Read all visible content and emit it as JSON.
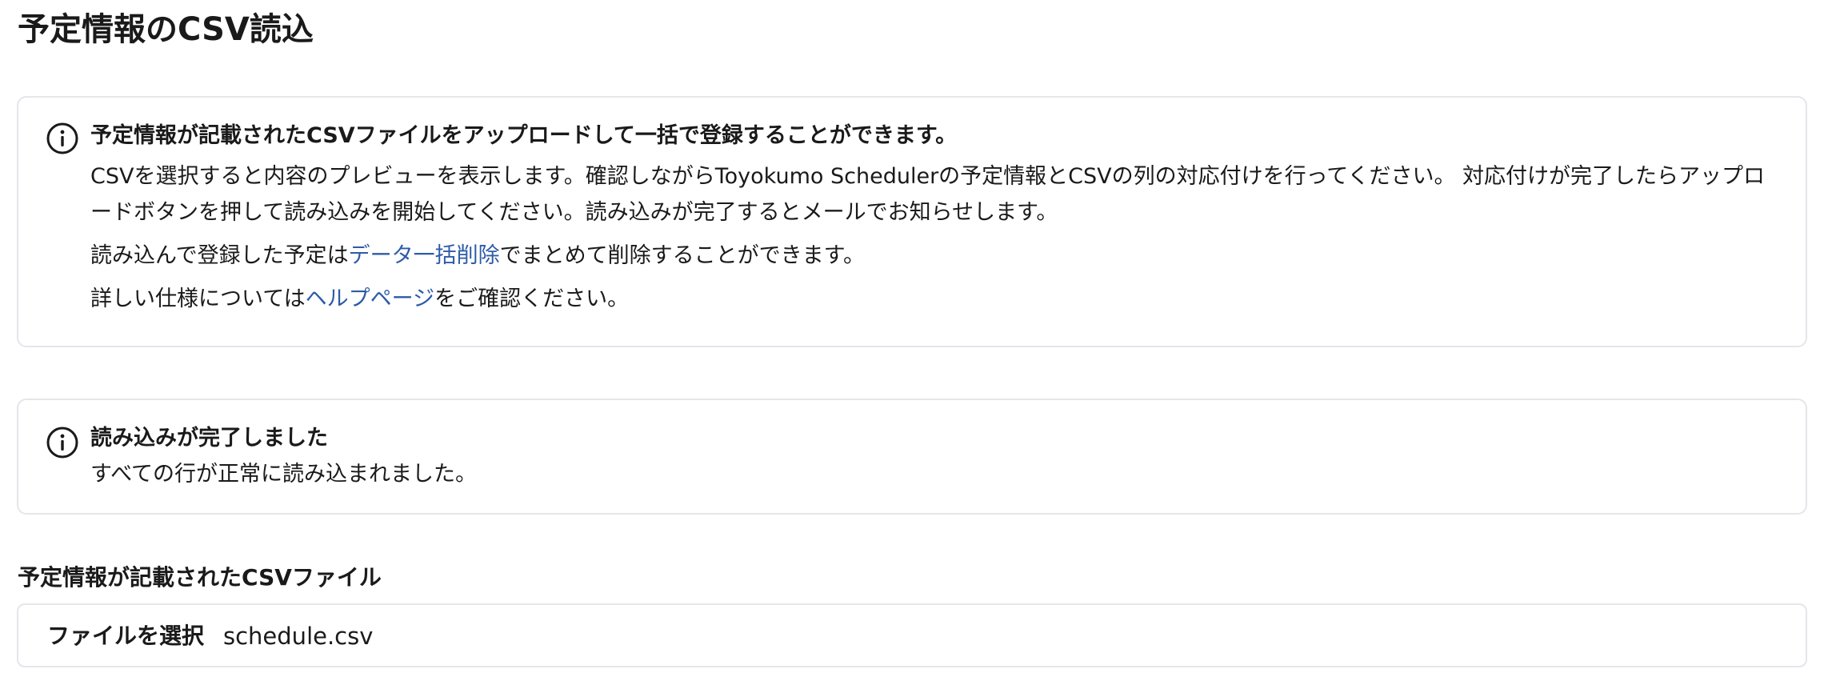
{
  "page": {
    "title": "予定情報のCSV読込"
  },
  "info_box": {
    "icon": "info-icon",
    "heading": "予定情報が記載されたCSVファイルをアップロードして一括で登録することができます。",
    "paragraph1": "CSVを選択すると内容のプレビューを表示します。確認しながらToyokumo Schedulerの予定情報とCSVの列の対応付けを行ってください。 対応付けが完了したらアップロードボタンを押して読み込みを開始してください。読み込みが完了するとメールでお知らせします。",
    "paragraph2": {
      "before": "読み込んで登録した予定は",
      "link": "データ一括削除",
      "after": "でまとめて削除することができます。"
    },
    "paragraph3": {
      "before": "詳しい仕様については",
      "link": "ヘルプページ",
      "after": "をご確認ください。"
    }
  },
  "result_box": {
    "icon": "info-icon",
    "heading": "読み込みが完了しました",
    "message": "すべての行が正常に読み込まれました。"
  },
  "file_field": {
    "label": "予定情報が記載されたCSVファイル",
    "button_label": "ファイルを選択",
    "file_name": "schedule.csv"
  },
  "colors": {
    "link": "#2e5ba8",
    "border": "#e4e6ea",
    "text": "#1a1a1a"
  }
}
